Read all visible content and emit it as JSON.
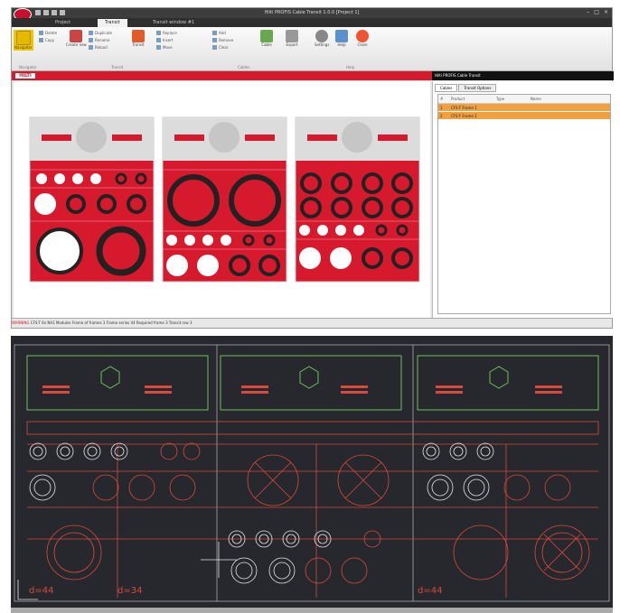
{
  "app": {
    "title": "Hilti PROFIS Cable Transit 1.0.0 [Project 1]",
    "logo_text": "HILTI",
    "window_controls": [
      "–",
      "□",
      "×"
    ]
  },
  "ribbon": {
    "tabs": [
      "Project",
      "Transit",
      "Transit window #1"
    ],
    "active_tab": "Transit",
    "buttons": [
      {
        "label": "Navigator",
        "icon": "navigator-icon"
      },
      {
        "label": "Create new",
        "icon": "create-icon"
      },
      {
        "label": "Transit",
        "icon": "transit-icon"
      },
      {
        "label": "Cable",
        "icon": "cable-icon"
      },
      {
        "label": "Export",
        "icon": "export-icon"
      },
      {
        "label": "Settings",
        "icon": "gear-icon"
      },
      {
        "label": "Help",
        "icon": "help-icon"
      },
      {
        "label": "Close",
        "icon": "close-icon"
      }
    ],
    "small_items": [
      "Delete",
      "Copy",
      "Duplicate",
      "Rename",
      "Reload",
      "Replace",
      "Insert",
      "Move",
      "Add",
      "Remove",
      "Clear"
    ],
    "groups": [
      "Navigator",
      "Transit",
      "Cables",
      "Help"
    ]
  },
  "right_panel": {
    "header": "Hilti PROFIS Cable Transit",
    "tabs": [
      "Cables",
      "Transit Options"
    ],
    "columns": [
      "#",
      "Product",
      "Type",
      "Name"
    ],
    "rows": [
      {
        "n": "1",
        "product": "CFS-T Frame 1",
        "type": "",
        "name": ""
      },
      {
        "n": "2",
        "product": "CFS-T Frame 2",
        "type": "",
        "name": ""
      }
    ]
  },
  "status_bar": {
    "warning": "WARNING",
    "text": "CFS-T 6x NA1 Modules   Frame of frames 3   Frame series 44   Required frame 3   Transit row 3"
  },
  "cad": {
    "labels": [
      "d=44",
      "d=34",
      "d=44"
    ]
  },
  "colors": {
    "brand": "#d7192d",
    "highlight": "#f0a040",
    "cad_bg": "#26282d"
  }
}
